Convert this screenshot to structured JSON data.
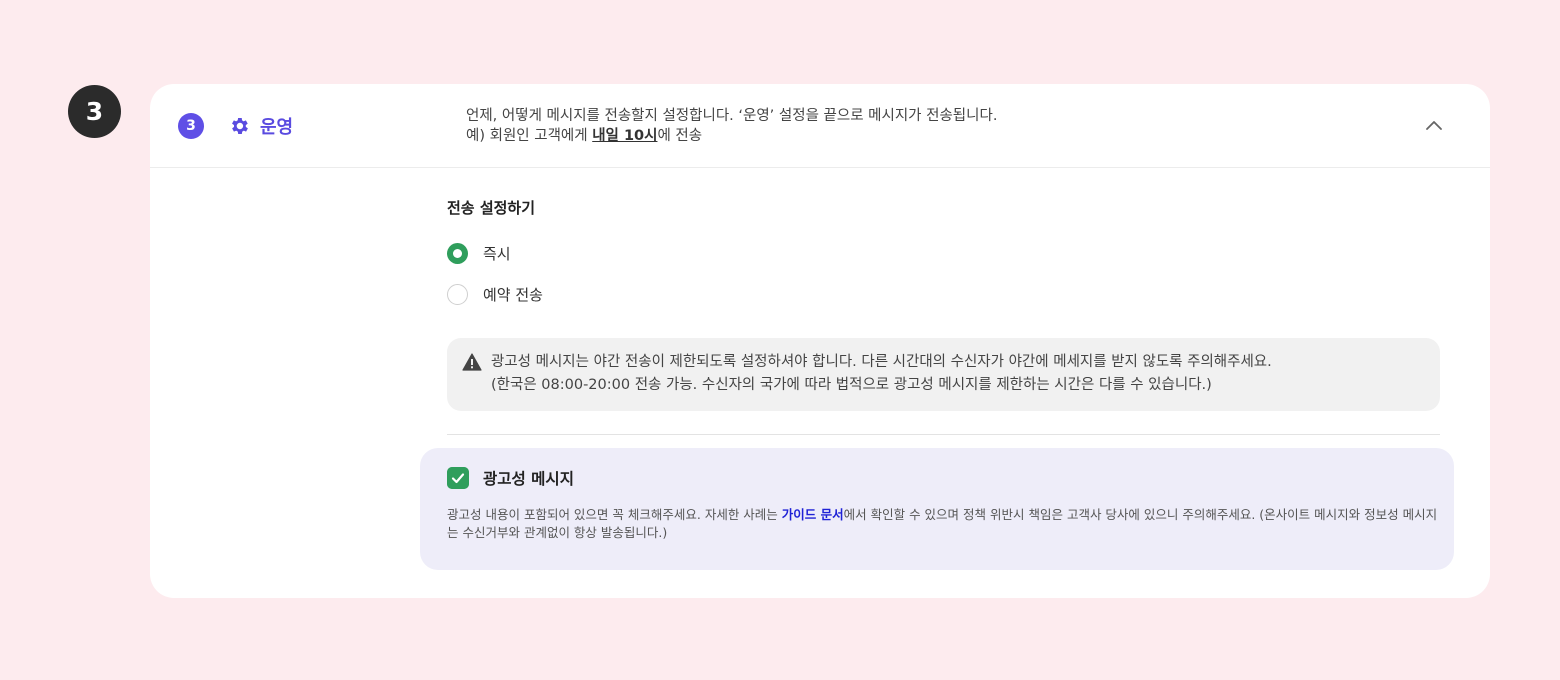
{
  "step_marker": {
    "number": "3"
  },
  "section": {
    "number": "3",
    "icon": "gear-icon",
    "title": "운영",
    "description_line1": "언제, 어떻게 메시지를 전송할지 설정합니다. ‘운영’ 설정을 끝으로 메시지가 전송됩니다.",
    "description_line2_prefix": "예) 회원인 고객에게 ",
    "description_line2_emphasis": "내일 10시",
    "description_line2_suffix": "에 전송",
    "collapse_icon": "chevron-up-icon"
  },
  "send_settings": {
    "title": "전송 설정하기",
    "options": [
      {
        "label": "즉시",
        "selected": true
      },
      {
        "label": "예약 전송",
        "selected": false
      }
    ]
  },
  "notice": {
    "icon": "warning-icon",
    "line1": "광고성 메시지는 야간 전송이 제한되도록 설정하셔야 합니다. 다른 시간대의 수신자가 야간에 메세지를 받지 않도록 주의해주세요.",
    "line2": "(한국은 08:00-20:00 전송 가능. 수신자의 국가에 따라 법적으로 광고성 메시지를 제한하는 시간은 다를 수 있습니다.)"
  },
  "ad_message": {
    "checked": true,
    "title": "광고성 메시지",
    "desc_prefix": "광고성 내용이 포함되어 있으면 꼭 체크해주세요. 자세한 사례는 ",
    "guide_link": "가이드 문서",
    "desc_suffix": "에서 확인할 수 있으며 정책 위반시 책임은 고객사 당사에 있으니 주의해주세요. (온사이트 메시지와 정보성 메시지는 수신거부와 관계없이 항상 발송됩니다.)"
  },
  "colors": {
    "accent": "#5f4fe6",
    "check_green": "#2f9e5c",
    "background": "#fdebee",
    "link": "#1f22d6"
  }
}
